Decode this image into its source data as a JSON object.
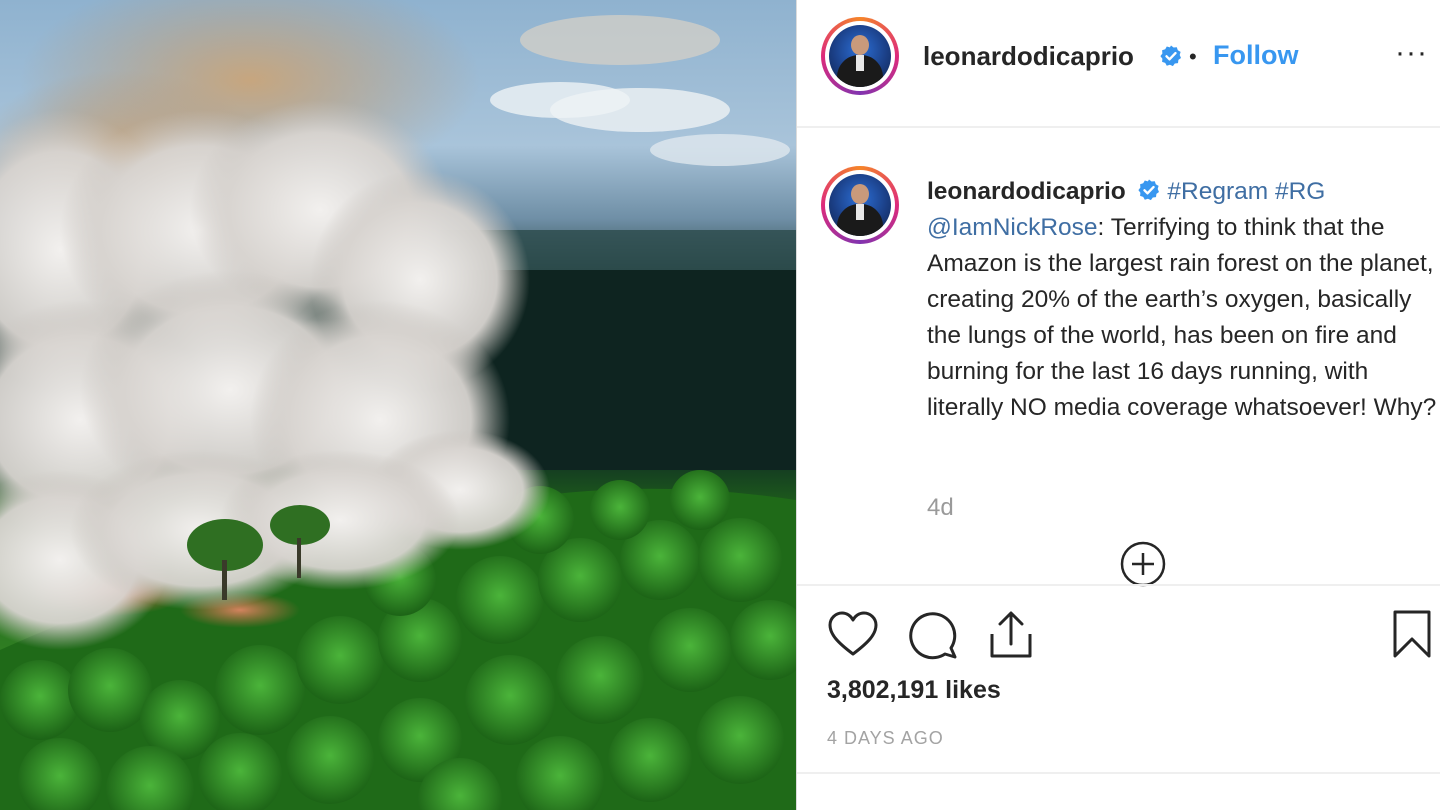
{
  "post": {
    "photo_alt": "Aerial view of smoke rising from burning Amazon rainforest",
    "header": {
      "username": "leonardodicaprio",
      "separator": "•",
      "follow_label": "Follow",
      "more_label": "···"
    },
    "caption": {
      "username": "leonardodicaprio",
      "tag1": "#Regram",
      "tag2": "#RG",
      "mention": "@IamNickRose",
      "text": ": Terrifying to think that the Amazon is the largest rain forest on the planet, creating 20% of the earth’s oxygen, basically the lungs of the world, has been on fire and burning for the last 16 days running, with literally NO media coverage whatsoever! Why?",
      "time": "4d"
    },
    "likes": "3,802,191 likes",
    "date": "4 DAYS AGO"
  },
  "icons": [
    "heart-icon",
    "comment-icon",
    "share-icon",
    "bookmark-icon",
    "verified-icon",
    "load-more-icon"
  ],
  "colors": {
    "link": "#3897f0",
    "hashtag": "#3f6ea3",
    "verified": "#3897f0",
    "muted": "#9a9a9a"
  }
}
